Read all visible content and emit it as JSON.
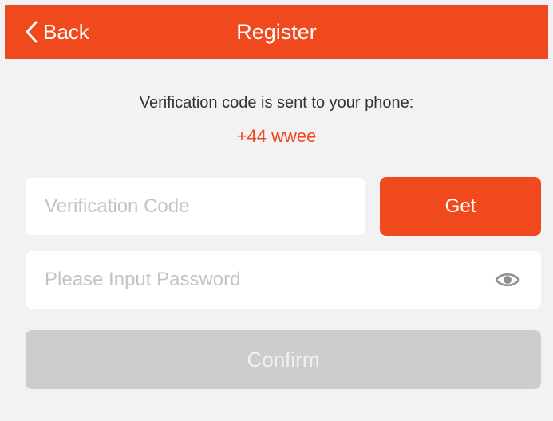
{
  "nav": {
    "back_label": "Back",
    "back_icon": "chevron-left-icon",
    "title": "Register"
  },
  "message": {
    "text": "Verification code is sent to your phone:",
    "phone": "+44 wwee"
  },
  "form": {
    "code_value": "",
    "code_placeholder": "Verification Code",
    "get_label": "Get",
    "password_value": "",
    "password_placeholder": "Please Input Password",
    "password_toggle_icon": "eye-icon",
    "confirm_label": "Confirm"
  },
  "colors": {
    "accent": "#f0491e",
    "background": "#f2f2f4",
    "disabled_button": "#cdcdd0"
  }
}
